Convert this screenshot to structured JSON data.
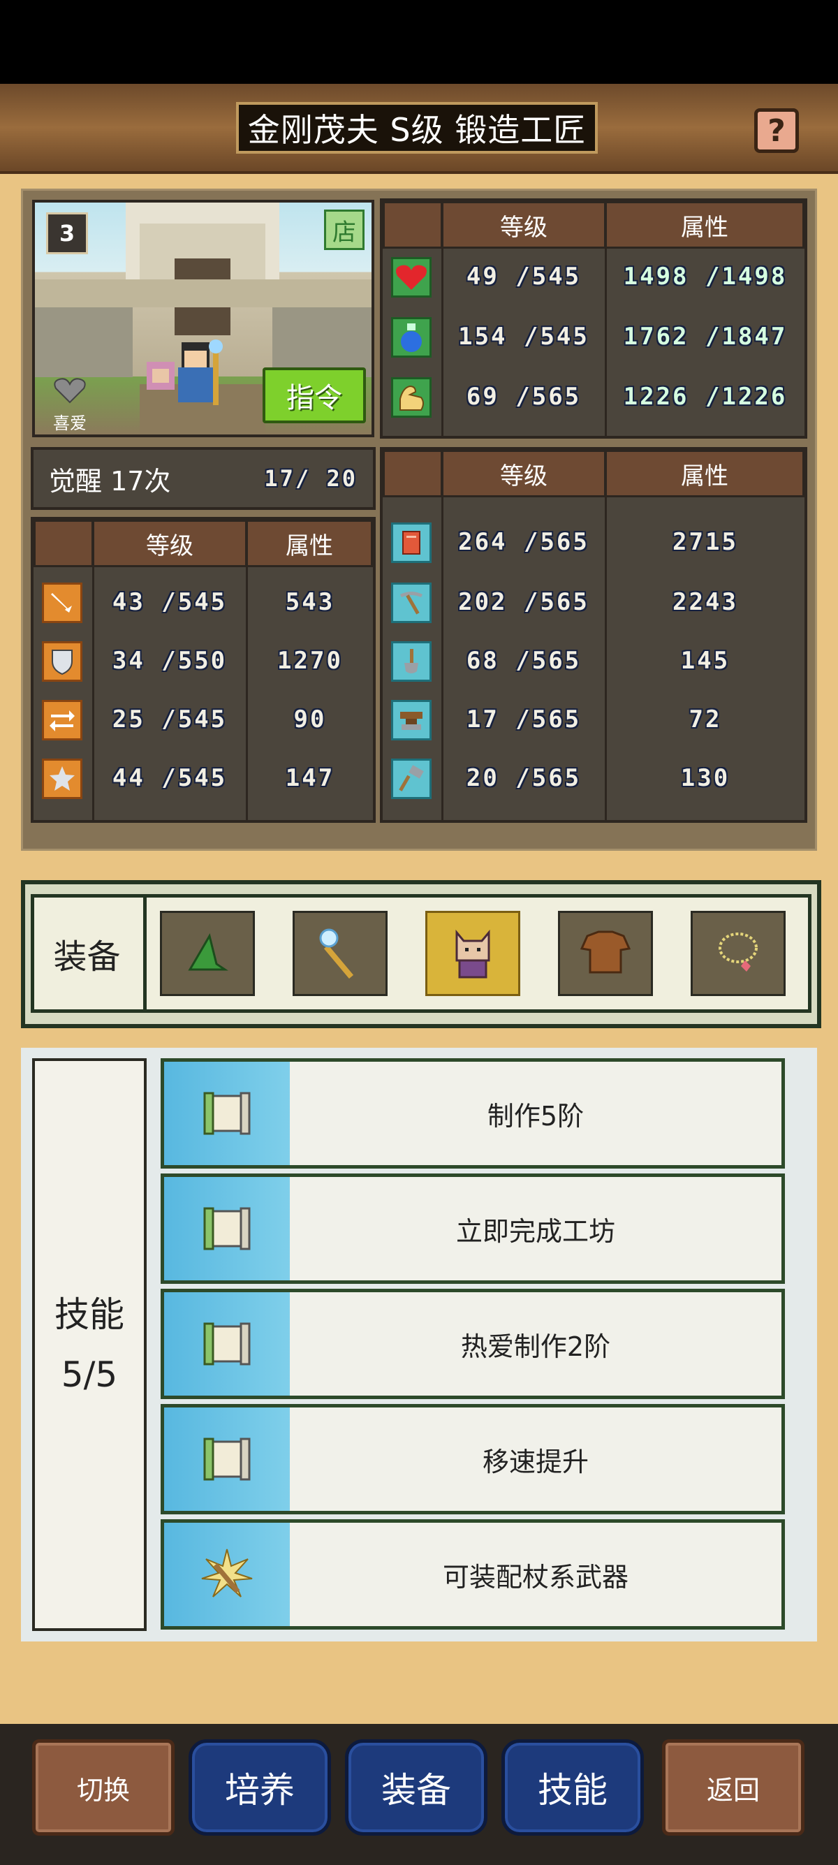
{
  "title": "金刚茂夫 S级 锻造工匠",
  "help_glyph": "?",
  "portrait": {
    "floor_badge": "3",
    "store_label": "店",
    "like_label": "喜爱",
    "command_label": "指令"
  },
  "vitals": {
    "header_level": "等级",
    "header_attr": "属性",
    "rows": [
      {
        "icon": "heart-icon",
        "level": "49 /545",
        "attr": "1498 /1498"
      },
      {
        "icon": "potion-icon",
        "level": "154 /545",
        "attr": "1762 /1847"
      },
      {
        "icon": "strength-icon",
        "level": "69 /565",
        "attr": "1226 /1226"
      }
    ]
  },
  "awaken": {
    "label": "觉醒 17次",
    "progress": "17/ 20"
  },
  "combat": {
    "header_level": "等级",
    "header_attr": "属性",
    "rows": [
      {
        "icon": "sword-icon",
        "level": "43 /545",
        "attr": "543"
      },
      {
        "icon": "shield-icon",
        "level": "34 /550",
        "attr": "1270"
      },
      {
        "icon": "speed-icon",
        "level": "25 /545",
        "attr": "90"
      },
      {
        "icon": "star-icon",
        "level": "44 /545",
        "attr": "147"
      }
    ]
  },
  "crafting": {
    "header_level": "等级",
    "header_attr": "属性",
    "rows": [
      {
        "icon": "book-icon",
        "level": "264 /565",
        "attr": "2715"
      },
      {
        "icon": "pickaxe-icon",
        "level": "202 /565",
        "attr": "2243"
      },
      {
        "icon": "shovel-icon",
        "level": "68 /565",
        "attr": "145"
      },
      {
        "icon": "anvil-icon",
        "level": "17 /565",
        "attr": "72"
      },
      {
        "icon": "hammer-icon",
        "level": "20 /565",
        "attr": "130"
      }
    ]
  },
  "equipment": {
    "label": "装备",
    "slots": [
      {
        "icon": "green-hat-icon",
        "selected": false
      },
      {
        "icon": "staff-icon",
        "selected": false
      },
      {
        "icon": "cat-doll-icon",
        "selected": true
      },
      {
        "icon": "leather-armor-icon",
        "selected": false
      },
      {
        "icon": "necklace-icon",
        "selected": false
      }
    ]
  },
  "skills": {
    "label": "技能",
    "count": "5/5",
    "items": [
      {
        "icon": "scroll-icon",
        "name": "制作5阶"
      },
      {
        "icon": "scroll-icon",
        "name": "立即完成工坊"
      },
      {
        "icon": "scroll-icon",
        "name": "热爱制作2阶"
      },
      {
        "icon": "scroll-icon",
        "name": "移速提升"
      },
      {
        "icon": "staff-burst-icon",
        "name": "可装配杖系武器"
      }
    ]
  },
  "nav": {
    "switch": "切换",
    "train": "培养",
    "equip": "装备",
    "skill": "技能",
    "back": "返回"
  },
  "colors": {
    "background": "#e9c483",
    "header": "#9a6c3d",
    "table_dark": "#4b453c",
    "table_header": "#6e4a33",
    "command_green": "#7ed02c",
    "skill_blue": "#58b8e0",
    "nav_blue": "#1d3a7c",
    "nav_brown": "#8d5a3f"
  }
}
